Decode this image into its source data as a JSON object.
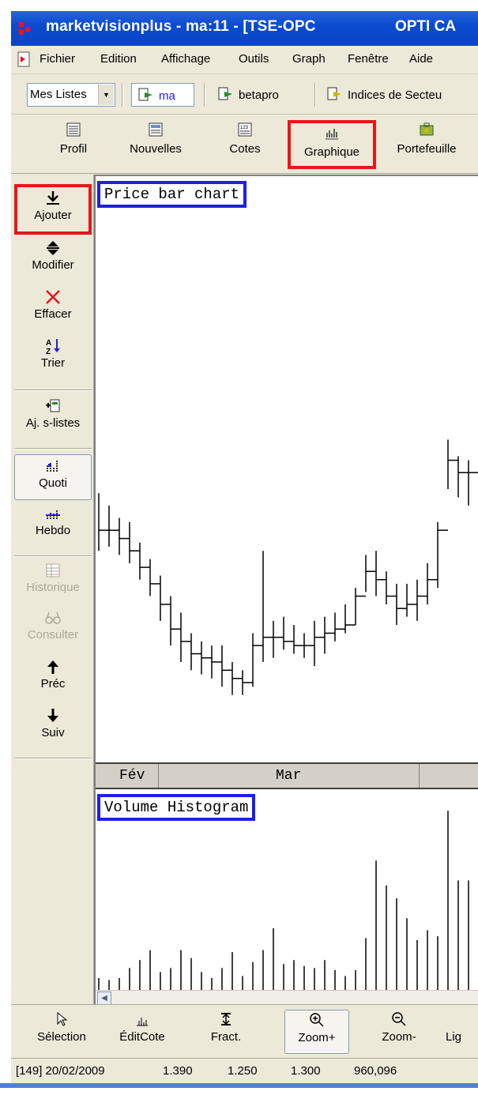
{
  "window": {
    "title": "marketvisionplus - ma:11 - [TSE-OPC",
    "title_right": "OPTI CA"
  },
  "menu": [
    "Fichier",
    "Edition",
    "Affichage",
    "Outils",
    "Graph",
    "Fenêtre",
    "Aide"
  ],
  "lists": {
    "combo_value": "Mes Listes",
    "items": [
      "ma",
      "betapro",
      "Indices de Secteu"
    ]
  },
  "top_toolbar": [
    "Profil",
    "Nouvelles",
    "Cotes",
    "Graphique",
    "Portefeuille"
  ],
  "left_toolbar": {
    "ajouter": "Ajouter",
    "modifier": "Modifier",
    "effacer": "Effacer",
    "trier": "Trier",
    "aj_slistes": "Aj. s-listes",
    "quoti": "Quoti",
    "hebdo": "Hebdo",
    "historique": "Historique",
    "consulter": "Consulter",
    "prec": "Préc",
    "suiv": "Suiv"
  },
  "chart": {
    "price_title": "Price bar chart",
    "volume_title": "Volume Histogram",
    "months": [
      "Fév",
      "Mar"
    ]
  },
  "bottom_toolbar": [
    "Sélection",
    "ÉditCote",
    "Fract.",
    "Zoom+",
    "Zoom-",
    "Lig"
  ],
  "status": {
    "record": "[149] 20/02/2009",
    "high": "1.390",
    "low": "1.250",
    "close": "1.300",
    "volume": "960,096"
  },
  "chart_data": {
    "type": "bar",
    "title": "Price bar chart",
    "price_bars": [
      {
        "high": 1.39,
        "low": 1.25,
        "close": 1.3
      },
      {
        "high": 1.36,
        "low": 1.26,
        "close": 1.3
      },
      {
        "high": 1.33,
        "low": 1.24,
        "close": 1.28
      },
      {
        "high": 1.32,
        "low": 1.22,
        "close": 1.25
      },
      {
        "high": 1.27,
        "low": 1.18,
        "close": 1.21
      },
      {
        "high": 1.23,
        "low": 1.14,
        "close": 1.17
      },
      {
        "high": 1.19,
        "low": 1.08,
        "close": 1.12
      },
      {
        "high": 1.14,
        "low": 1.02,
        "close": 1.06
      },
      {
        "high": 1.1,
        "low": 0.98,
        "close": 1.03
      },
      {
        "high": 1.05,
        "low": 0.96,
        "close": 1.0
      },
      {
        "high": 1.03,
        "low": 0.95,
        "close": 0.99
      },
      {
        "high": 1.02,
        "low": 0.94,
        "close": 0.98
      },
      {
        "high": 1.02,
        "low": 0.92,
        "close": 0.96
      },
      {
        "high": 0.98,
        "low": 0.9,
        "close": 0.94
      },
      {
        "high": 0.96,
        "low": 0.9,
        "close": 0.93
      },
      {
        "high": 1.05,
        "low": 0.92,
        "close": 1.02
      },
      {
        "high": 1.25,
        "low": 0.98,
        "close": 1.04
      },
      {
        "high": 1.08,
        "low": 0.99,
        "close": 1.04
      },
      {
        "high": 1.09,
        "low": 1.01,
        "close": 1.03
      },
      {
        "high": 1.07,
        "low": 1.0,
        "close": 1.02
      },
      {
        "high": 1.05,
        "low": 0.99,
        "close": 1.02
      },
      {
        "high": 1.08,
        "low": 0.97,
        "close": 1.04
      },
      {
        "high": 1.09,
        "low": 1.0,
        "close": 1.05
      },
      {
        "high": 1.1,
        "low": 1.03,
        "close": 1.06
      },
      {
        "high": 1.12,
        "low": 1.05,
        "close": 1.07
      },
      {
        "high": 1.16,
        "low": 1.07,
        "close": 1.14
      },
      {
        "high": 1.24,
        "low": 1.15,
        "close": 1.2
      },
      {
        "high": 1.25,
        "low": 1.14,
        "close": 1.18
      },
      {
        "high": 1.2,
        "low": 1.12,
        "close": 1.14
      },
      {
        "high": 1.17,
        "low": 1.07,
        "close": 1.11
      },
      {
        "high": 1.17,
        "low": 1.09,
        "close": 1.12
      },
      {
        "high": 1.18,
        "low": 1.08,
        "close": 1.14
      },
      {
        "high": 1.22,
        "low": 1.12,
        "close": 1.18
      },
      {
        "high": 1.32,
        "low": 1.16,
        "close": 1.3
      },
      {
        "high": 1.52,
        "low": 1.4,
        "close": 1.47
      },
      {
        "high": 1.48,
        "low": 1.38,
        "close": 1.44
      },
      {
        "high": 1.47,
        "low": 1.36,
        "close": 1.44
      }
    ],
    "volume_title": "Volume Histogram",
    "volumes": [
      12,
      10,
      12,
      22,
      30,
      40,
      18,
      22,
      40,
      32,
      18,
      12,
      22,
      38,
      14,
      28,
      40,
      62,
      26,
      30,
      24,
      22,
      30,
      20,
      14,
      20,
      52,
      130,
      105,
      92,
      72,
      50,
      60,
      54,
      180,
      110,
      110
    ]
  }
}
